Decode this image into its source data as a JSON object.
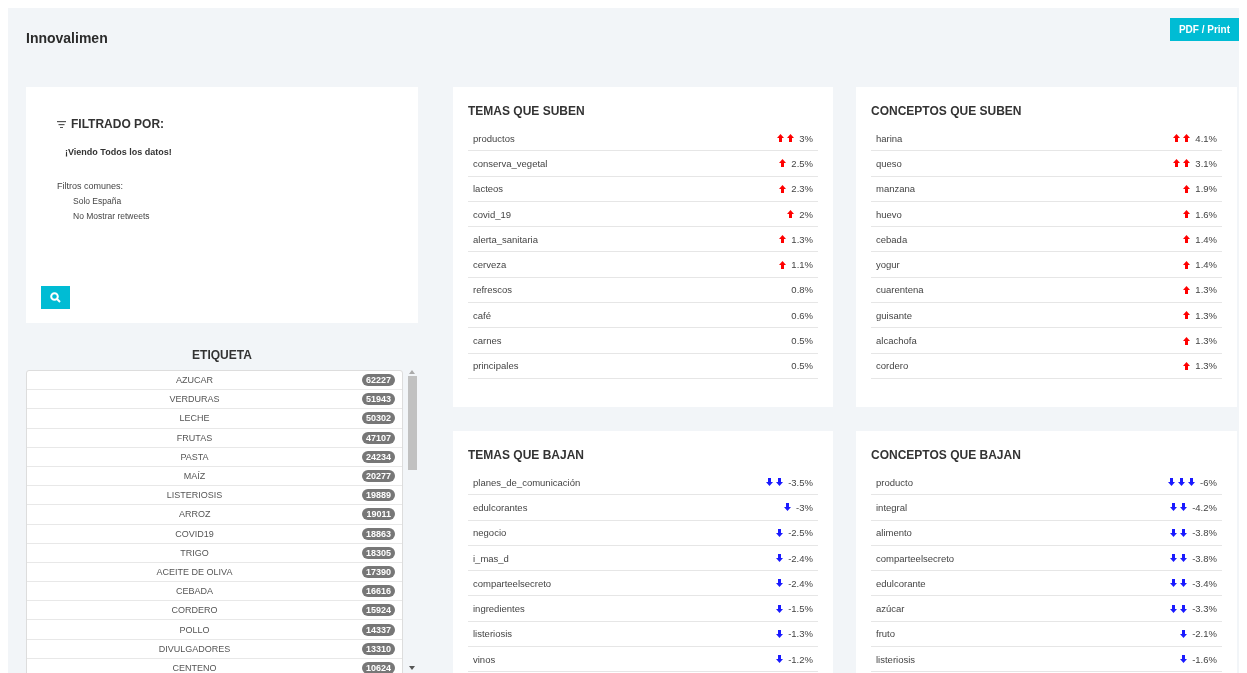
{
  "header": {
    "title": "Innovalimen",
    "print_button": "PDF / Print"
  },
  "filter": {
    "title": "FILTRADO POR:",
    "status": "¡Viendo Todos los datos!",
    "common_label": "Filtros comunes:",
    "common_items": [
      "Solo España",
      "No Mostrar retweets"
    ]
  },
  "tags": {
    "title": "ETIQUETA",
    "items": [
      {
        "label": "AZUCAR",
        "count": "62227"
      },
      {
        "label": "VERDURAS",
        "count": "51943"
      },
      {
        "label": "LECHE",
        "count": "50302"
      },
      {
        "label": "FRUTAS",
        "count": "47107"
      },
      {
        "label": "PASTA",
        "count": "24234"
      },
      {
        "label": "MAÍZ",
        "count": "20277"
      },
      {
        "label": "LISTERIOSIS",
        "count": "19889"
      },
      {
        "label": "ARROZ",
        "count": "19011"
      },
      {
        "label": "COVID19",
        "count": "18863"
      },
      {
        "label": "TRIGO",
        "count": "18305"
      },
      {
        "label": "ACEITE DE OLIVA",
        "count": "17390"
      },
      {
        "label": "CEBADA",
        "count": "16616"
      },
      {
        "label": "CORDERO",
        "count": "15924"
      },
      {
        "label": "POLLO",
        "count": "14337"
      },
      {
        "label": "DIVULGADORES",
        "count": "13310"
      },
      {
        "label": "CENTENO",
        "count": "10624"
      }
    ]
  },
  "panels": [
    {
      "title": "TEMAS QUE SUBEN",
      "rows": [
        {
          "term": "productos",
          "arrows": [
            {
              "kind": "up"
            },
            {
              "kind": "up"
            }
          ],
          "change": "3%"
        },
        {
          "term": "conserva_vegetal",
          "arrows": [
            {
              "kind": "up"
            }
          ],
          "change": "2.5%"
        },
        {
          "term": "lacteos",
          "arrows": [
            {
              "kind": "up"
            }
          ],
          "change": "2.3%"
        },
        {
          "term": "covid_19",
          "arrows": [
            {
              "kind": "up"
            }
          ],
          "change": "2%"
        },
        {
          "term": "alerta_sanitaria",
          "arrows": [
            {
              "kind": "up"
            }
          ],
          "change": "1.3%"
        },
        {
          "term": "cerveza",
          "arrows": [
            {
              "kind": "up"
            }
          ],
          "change": "1.1%"
        },
        {
          "term": "refrescos",
          "change": "0.8%"
        },
        {
          "term": "café",
          "change": "0.6%"
        },
        {
          "term": "carnes",
          "change": "0.5%"
        },
        {
          "term": "principales",
          "change": "0.5%"
        }
      ]
    },
    {
      "title": "CONCEPTOS QUE SUBEN",
      "rows": [
        {
          "term": "harina",
          "arrows": [
            {
              "kind": "up"
            },
            {
              "kind": "up"
            }
          ],
          "change": "4.1%"
        },
        {
          "term": "queso",
          "arrows": [
            {
              "kind": "up"
            },
            {
              "kind": "up"
            }
          ],
          "change": "3.1%"
        },
        {
          "term": "manzana",
          "arrows": [
            {
              "kind": "up"
            }
          ],
          "change": "1.9%"
        },
        {
          "term": "huevo",
          "arrows": [
            {
              "kind": "up"
            }
          ],
          "change": "1.6%"
        },
        {
          "term": "cebada",
          "arrows": [
            {
              "kind": "up"
            }
          ],
          "change": "1.4%"
        },
        {
          "term": "yogur",
          "arrows": [
            {
              "kind": "up"
            }
          ],
          "change": "1.4%"
        },
        {
          "term": "cuarentena",
          "arrows": [
            {
              "kind": "up"
            }
          ],
          "change": "1.3%"
        },
        {
          "term": "guisante",
          "arrows": [
            {
              "kind": "up"
            }
          ],
          "change": "1.3%"
        },
        {
          "term": "alcachofa",
          "arrows": [
            {
              "kind": "up"
            }
          ],
          "change": "1.3%"
        },
        {
          "term": "cordero",
          "arrows": [
            {
              "kind": "up"
            }
          ],
          "change": "1.3%"
        }
      ]
    },
    {
      "title": "TEMAS QUE BAJAN",
      "rows": [
        {
          "term": "planes_de_comunicación",
          "arrows": [
            {
              "kind": "down"
            },
            {
              "kind": "down"
            }
          ],
          "change": "-3.5%"
        },
        {
          "term": "edulcorantes",
          "arrows": [
            {
              "kind": "down"
            }
          ],
          "change": "-3%"
        },
        {
          "term": "negocio",
          "arrows": [
            {
              "kind": "down"
            }
          ],
          "change": "-2.5%"
        },
        {
          "term": "i_mas_d",
          "arrows": [
            {
              "kind": "down"
            }
          ],
          "change": "-2.4%"
        },
        {
          "term": "comparteelsecreto",
          "arrows": [
            {
              "kind": "down"
            }
          ],
          "change": "-2.4%"
        },
        {
          "term": "ingredientes",
          "arrows": [
            {
              "kind": "down"
            }
          ],
          "change": "-1.5%"
        },
        {
          "term": "listeriosis",
          "arrows": [
            {
              "kind": "down"
            }
          ],
          "change": "-1.3%"
        },
        {
          "term": "vinos",
          "arrows": [
            {
              "kind": "down"
            }
          ],
          "change": "-1.2%"
        }
      ]
    },
    {
      "title": "CONCEPTOS QUE BAJAN",
      "rows": [
        {
          "term": "producto",
          "arrows": [
            {
              "kind": "down"
            },
            {
              "kind": "down"
            },
            {
              "kind": "down"
            }
          ],
          "change": "-6%"
        },
        {
          "term": "integral",
          "arrows": [
            {
              "kind": "down"
            },
            {
              "kind": "down"
            }
          ],
          "change": "-4.2%"
        },
        {
          "term": "alimento",
          "arrows": [
            {
              "kind": "down"
            },
            {
              "kind": "down"
            }
          ],
          "change": "-3.8%"
        },
        {
          "term": "comparteelsecreto",
          "arrows": [
            {
              "kind": "down"
            },
            {
              "kind": "down"
            }
          ],
          "change": "-3.8%"
        },
        {
          "term": "edulcorante",
          "arrows": [
            {
              "kind": "down"
            },
            {
              "kind": "down"
            }
          ],
          "change": "-3.4%"
        },
        {
          "term": "azúcar",
          "arrows": [
            {
              "kind": "down"
            },
            {
              "kind": "down"
            }
          ],
          "change": "-3.3%"
        },
        {
          "term": "fruto",
          "arrows": [
            {
              "kind": "down"
            }
          ],
          "change": "-2.1%"
        },
        {
          "term": "listeriosis",
          "arrows": [
            {
              "kind": "down"
            }
          ],
          "change": "-1.6%"
        }
      ]
    }
  ]
}
